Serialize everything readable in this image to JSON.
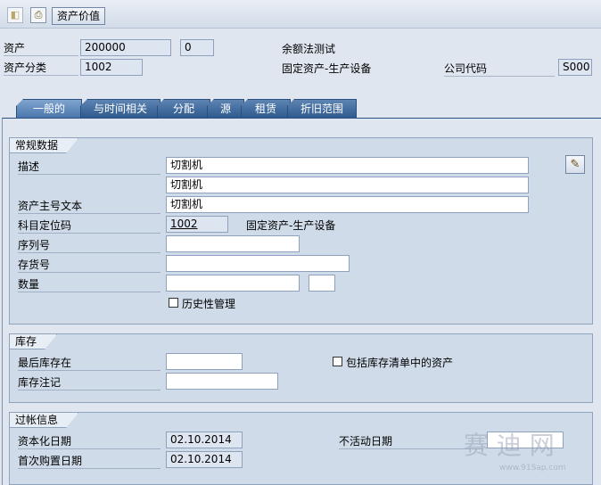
{
  "toolbar": {
    "icon1": "◧",
    "icon2": "⎙",
    "asset_value_button": "资产价值"
  },
  "header": {
    "asset_label": "资产",
    "asset_number": "200000",
    "sub_number": "0",
    "asset_class_label": "资产分类",
    "asset_class": "1002",
    "description": "余额法测试",
    "class_description": "固定资产-生产设备",
    "company_code_label": "公司代码",
    "company_code": "S000"
  },
  "tabs": [
    {
      "label": "一般的",
      "active": true
    },
    {
      "label": "与时间相关",
      "active": false
    },
    {
      "label": "分配",
      "active": false
    },
    {
      "label": "源",
      "active": false
    },
    {
      "label": "租赁",
      "active": false
    },
    {
      "label": "折旧范围",
      "active": false
    }
  ],
  "general_data": {
    "title": "常规数据",
    "description_label": "描述",
    "description_1": "切割机",
    "description_2": "切割机",
    "main_number_text_label": "资产主号文本",
    "main_number_text": "切割机",
    "account_determination_label": "科目定位码",
    "account_determination": "1002",
    "account_determination_text": "固定资产-生产设备",
    "serial_number_label": "序列号",
    "serial_number": "",
    "inventory_number_label": "存货号",
    "inventory_number": "",
    "quantity_label": "数量",
    "quantity": "",
    "quantity_unit": "",
    "history_checkbox_label": "历史性管理",
    "history_checked": false,
    "edit_icon": "✎"
  },
  "inventory": {
    "title": "库存",
    "last_inventory_label": "最后库存在",
    "last_inventory": "",
    "inventory_note_label": "库存注记",
    "inventory_note": "",
    "include_checkbox_label": "包括库存清单中的资产",
    "include_checked": false
  },
  "posting": {
    "title": "过帐信息",
    "capitalization_date_label": "资本化日期",
    "capitalization_date": "02.10.2014",
    "first_acquisition_label": "首次购置日期",
    "first_acquisition_date": "02.10.2014",
    "deactivation_date_label": "不活动日期",
    "deactivation_date": ""
  },
  "watermark": {
    "big": "赛 迪 网",
    "small": "www.91Sap.com"
  },
  "colors": {
    "tab_active": "#4a77ad",
    "tab": "#2f5a8e",
    "panel_background": "#cfdbe8"
  }
}
